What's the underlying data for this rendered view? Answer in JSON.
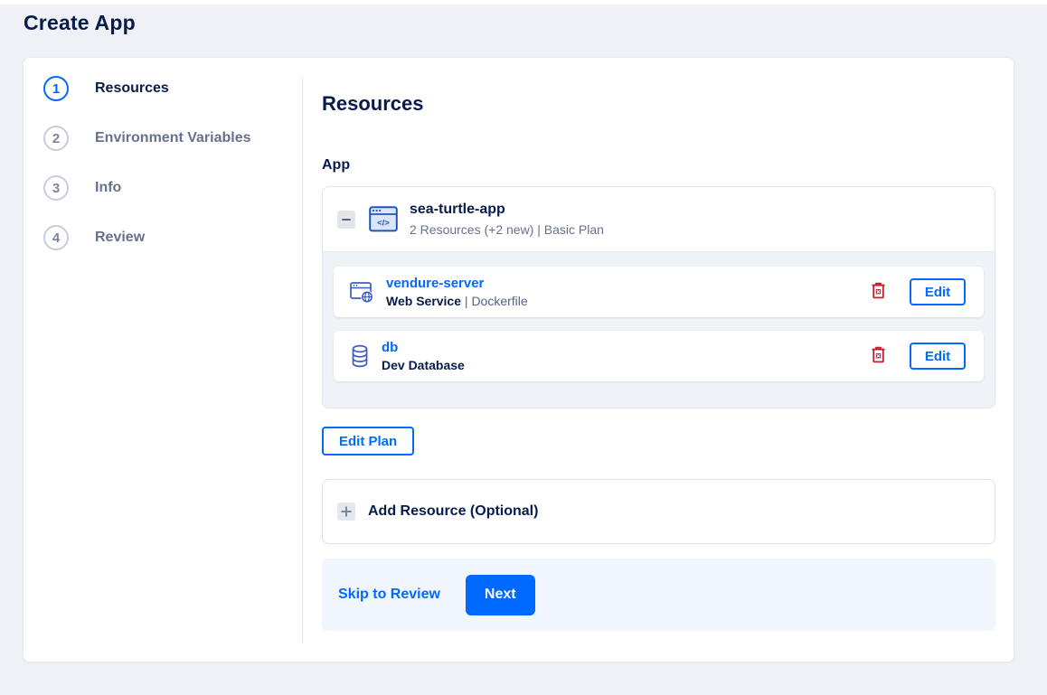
{
  "page": {
    "title": "Create App"
  },
  "colors": {
    "accent": "#0069ff",
    "navy": "#081c4b",
    "gray_text": "#67718c",
    "danger": "#c21f2e",
    "page_bg": "#eff1f6",
    "footer_bg": "#f0f6fc"
  },
  "icons": {
    "collapse": "minus-icon",
    "app": "app-window-code-icon",
    "web_service": "browser-globe-icon",
    "database": "database-cylinder-icon",
    "delete": "trash-icon",
    "add": "plus-icon"
  },
  "stepper": {
    "steps": [
      {
        "number": "1",
        "label": "Resources",
        "active": true
      },
      {
        "number": "2",
        "label": "Environment Variables",
        "active": false
      },
      {
        "number": "3",
        "label": "Info",
        "active": false
      },
      {
        "number": "4",
        "label": "Review",
        "active": false
      }
    ]
  },
  "content": {
    "heading": "Resources",
    "section_label": "App",
    "app_card": {
      "name": "sea-turtle-app",
      "summary": "2 Resources (+2 new) | Basic Plan",
      "resources": [
        {
          "name": "vendure-server",
          "type": "Web Service",
          "separator": " | ",
          "detail": "Dockerfile",
          "edit_label": "Edit"
        },
        {
          "name": "db",
          "type": "Dev Database",
          "separator": "",
          "detail": "",
          "edit_label": "Edit"
        }
      ]
    },
    "edit_plan_label": "Edit Plan",
    "add_resource_label": "Add Resource (Optional)",
    "footer": {
      "skip_label": "Skip to Review",
      "next_label": "Next"
    }
  }
}
